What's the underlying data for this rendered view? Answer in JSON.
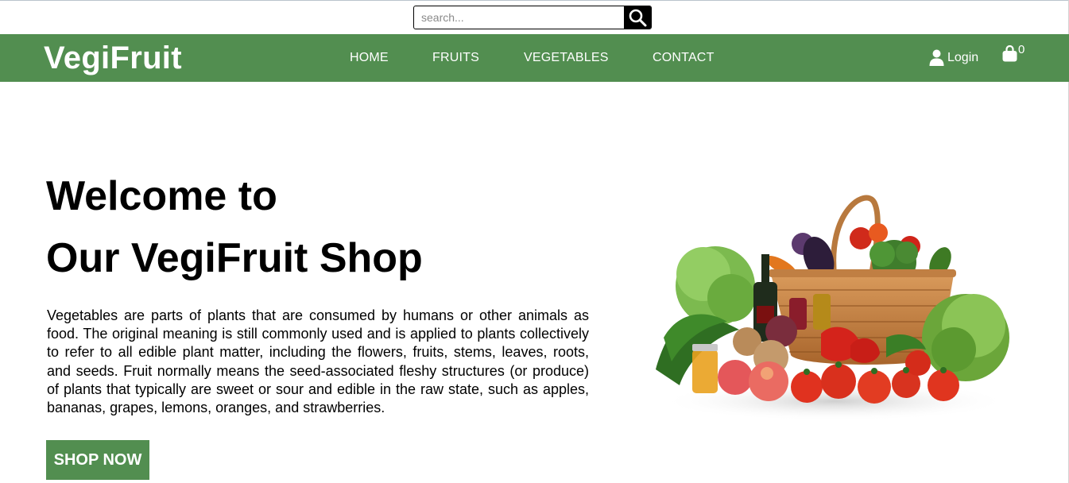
{
  "search": {
    "placeholder": "search...",
    "icon": "search-icon"
  },
  "header": {
    "logo": "VegiFruit",
    "nav": [
      {
        "label": "HOME"
      },
      {
        "label": "FRUITS"
      },
      {
        "label": "VEGETABLES"
      },
      {
        "label": "CONTACT"
      }
    ],
    "login_label": "Login",
    "login_icon": "user-icon",
    "cart_icon": "shopping-bag-icon",
    "cart_count": "0"
  },
  "hero": {
    "title_line1": "Welcome to",
    "title_line2": "Our VegiFruit Shop",
    "description": "Vegetables are parts of plants that are consumed by humans or other animals as food. The original meaning is still commonly used and is applied to plants collectively to refer to all edible plant matter, including the flowers, fruits, stems, leaves, roots, and seeds. Fruit normally means the seed-associated fleshy structures (or produce) of plants that typically are sweet or sour and edible in the raw state, such as apples, bananas, grapes, lemons, oranges, and strawberries.",
    "button_label": "SHOP NOW",
    "image": "vegetable-fruit-basket-image"
  },
  "colors": {
    "brand": "#528e50",
    "text": "#000000",
    "background": "#ffffff"
  }
}
